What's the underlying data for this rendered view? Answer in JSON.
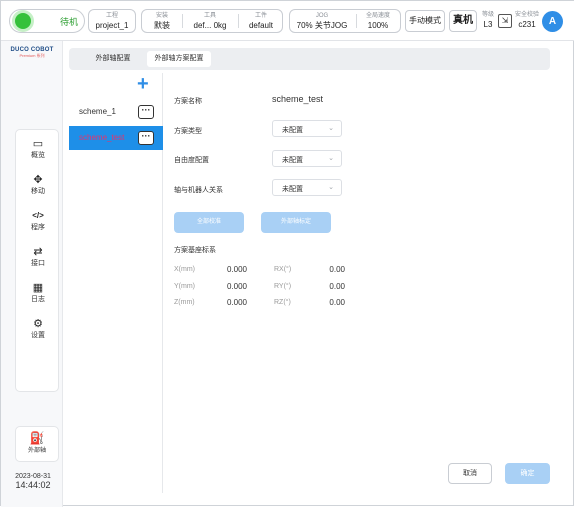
{
  "topbar": {
    "status": "待机",
    "tool": {
      "label": "工程",
      "value": "project_1"
    },
    "install": {
      "label": "安装",
      "value": "默装"
    },
    "tool2": {
      "label": "工具",
      "value1": "def...",
      "value2": "0kg"
    },
    "workpiece": {
      "label": "工件",
      "value": "default"
    },
    "jog": {
      "label": "JOG",
      "value": "70%  关节JOG"
    },
    "speed": {
      "label": "全局速度",
      "value": "100%"
    },
    "mode_button": "手动模式",
    "real_button": "真机",
    "level": {
      "label": "等级",
      "value": "L3"
    },
    "safety": {
      "label": "安全校验",
      "value": "c231"
    },
    "avatar": "A"
  },
  "sidebar": {
    "logo_line1": "DUCO COBOT",
    "logo_line2": "Premium 系列",
    "items": [
      {
        "label": "概览",
        "icon": "monitor-icon"
      },
      {
        "label": "移动",
        "icon": "move-icon"
      },
      {
        "label": "程序",
        "icon": "code-icon"
      },
      {
        "label": "接口",
        "icon": "interface-icon"
      },
      {
        "label": "日志",
        "icon": "calendar-icon"
      },
      {
        "label": "设置",
        "icon": "gear-icon"
      }
    ],
    "external_axis": "外部轴",
    "date": "2023-08-31",
    "time": "14:44:02"
  },
  "tabs": [
    "外部轴配置",
    "外部轴方案配置"
  ],
  "schemes": [
    {
      "name": "scheme_1",
      "selected": false
    },
    {
      "name": "scheme_test",
      "selected": true
    }
  ],
  "form": {
    "name_label": "方案名称",
    "name_value": "scheme_test",
    "type_label": "方案类型",
    "type_value": "未配置",
    "dof_label": "自由度配置",
    "dof_value": "未配置",
    "relation_label": "轴与机器人关系",
    "relation_value": "未配置",
    "btn_full_calib": "全部校准",
    "btn_axis_calib": "外部轴标定",
    "coord_title": "方案基座标系",
    "coords": [
      {
        "label": "X(mm)",
        "value": "0.000",
        "rlabel": "RX(°)",
        "rvalue": "0.00"
      },
      {
        "label": "Y(mm)",
        "value": "0.000",
        "rlabel": "RY(°)",
        "rvalue": "0.00"
      },
      {
        "label": "Z(mm)",
        "value": "0.000",
        "rlabel": "RZ(°)",
        "rvalue": "0.00"
      }
    ]
  },
  "footer": {
    "cancel": "取消",
    "confirm": "确定"
  },
  "colors": {
    "accent": "#2f8ee6",
    "selected_row": "#1e8fe8",
    "disabled_button": "#a9d0f5",
    "status_green": "#35c13b"
  }
}
